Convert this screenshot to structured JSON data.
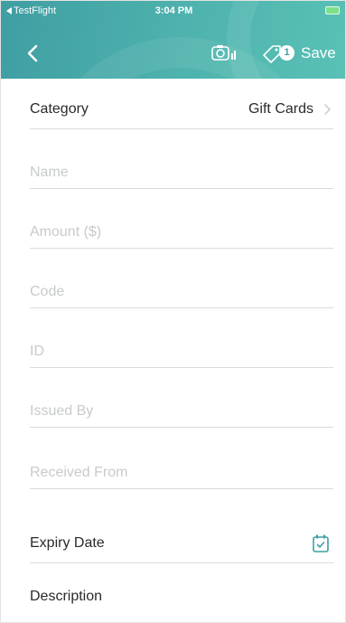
{
  "status_bar": {
    "back_app": "TestFlight",
    "time": "3:04 PM"
  },
  "nav_bar": {
    "badge_count": "1",
    "save_label": "Save",
    "icons": [
      "back-chevron-icon",
      "camera-icon",
      "tag-icon"
    ]
  },
  "form": {
    "category": {
      "label": "Category",
      "value": "Gift Cards"
    },
    "name": {
      "placeholder": "Name"
    },
    "amount": {
      "placeholder": "Amount ($)"
    },
    "code": {
      "placeholder": "Code"
    },
    "id": {
      "placeholder": "ID"
    },
    "issued_by": {
      "placeholder": "Issued By"
    },
    "received_from": {
      "placeholder": "Received From"
    },
    "expiry_date": {
      "label": "Expiry Date"
    },
    "description": {
      "label": "Description"
    }
  },
  "colors": {
    "header_start": "#3f9ea2",
    "header_end": "#59c1b6",
    "divider": "#d9dcdc",
    "placeholder": "#c8cbcb",
    "accent": "#3f9ea2"
  }
}
